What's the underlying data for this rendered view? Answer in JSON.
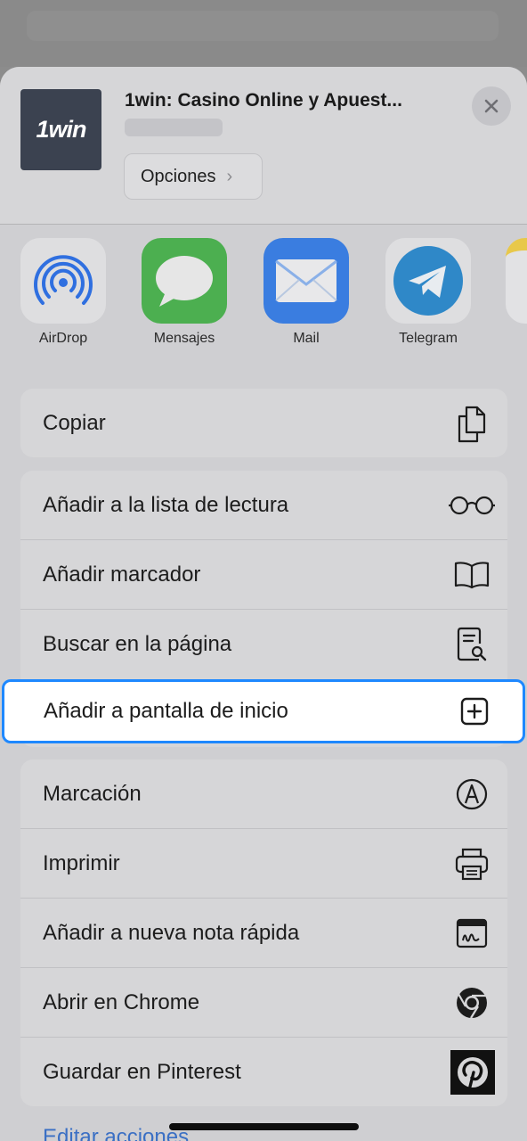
{
  "header": {
    "site_title": "1win: Casino Online y Apuest...",
    "thumb_logo": "1win",
    "options_label": "Opciones",
    "close_icon": "close-icon"
  },
  "apps": [
    {
      "label": "AirDrop",
      "icon": "airdrop-icon"
    },
    {
      "label": "Mensajes",
      "icon": "messages-icon"
    },
    {
      "label": "Mail",
      "icon": "mail-icon"
    },
    {
      "label": "Telegram",
      "icon": "telegram-icon"
    }
  ],
  "actions": {
    "copy": {
      "label": "Copiar",
      "icon": "copy-icon"
    },
    "reading_list": {
      "label": "Añadir a la lista de lectura",
      "icon": "glasses-icon"
    },
    "bookmark": {
      "label": "Añadir marcador",
      "icon": "book-icon"
    },
    "find": {
      "label": "Buscar en la página",
      "icon": "find-in-page-icon"
    },
    "home_screen": {
      "label": "Añadir a pantalla de inicio",
      "icon": "add-square-icon"
    },
    "markup": {
      "label": "Marcación",
      "icon": "markup-icon"
    },
    "print": {
      "label": "Imprimir",
      "icon": "printer-icon"
    },
    "quick_note": {
      "label": "Añadir a nueva nota rápida",
      "icon": "quick-note-icon"
    },
    "chrome": {
      "label": "Abrir en Chrome",
      "icon": "chrome-icon"
    },
    "pinterest": {
      "label": "Guardar en Pinterest",
      "icon": "pinterest-icon"
    }
  },
  "footer": {
    "edit_actions": "Editar acciones..."
  },
  "colors": {
    "highlight_border": "#1e88ff",
    "link": "#3a6fc4"
  }
}
